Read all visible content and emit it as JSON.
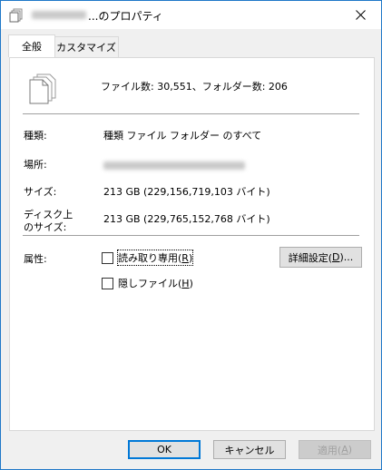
{
  "window": {
    "title_suffix": "...のプロパティ",
    "tabs": [
      {
        "label": "全般",
        "active": true
      },
      {
        "label": "カスタマイズ",
        "active": false
      }
    ]
  },
  "summary": {
    "count_text": "ファイル数: 30,551、フォルダー数: 206"
  },
  "properties": {
    "type_label": "種類:",
    "type_value": "種類 ファイル フォルダー のすべて",
    "location_label": "場所:",
    "size_label": "サイズ:",
    "size_value": "213 GB (229,156,719,103 バイト)",
    "disk_size_label_1": "ディスク上",
    "disk_size_label_2": "のサイズ:",
    "disk_size_value": "213 GB (229,765,152,768 バイト)"
  },
  "attributes": {
    "label": "属性:",
    "readonly_text": "読み取り専用(",
    "readonly_key": "R",
    "readonly_close": ")",
    "hidden_text": "隠しファイル(",
    "hidden_key": "H",
    "hidden_close": ")",
    "advanced_text": "詳細設定(",
    "advanced_key": "D",
    "advanced_close": ")..."
  },
  "footer": {
    "ok": "OK",
    "cancel": "キャンセル",
    "apply_text": "適用(",
    "apply_key": "A",
    "apply_close": ")"
  }
}
